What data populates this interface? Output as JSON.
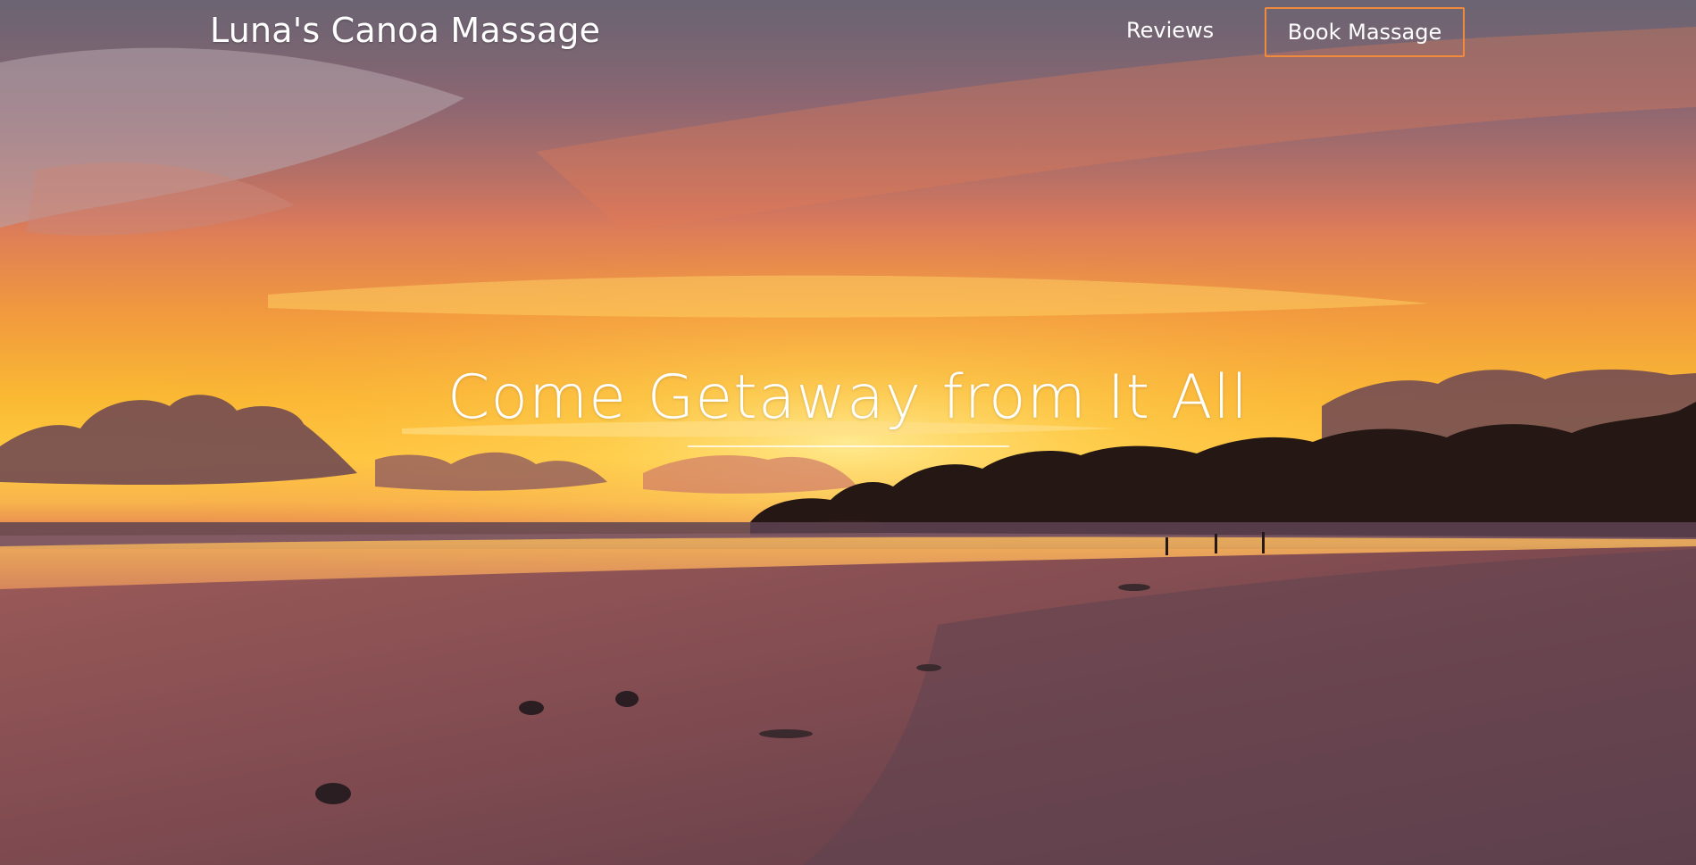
{
  "header": {
    "brand": "Luna's Canoa Massage",
    "nav_reviews": "Reviews",
    "nav_book": "Book Massage"
  },
  "hero": {
    "headline": "Come Getaway from It All",
    "image": "sunset-beach-photo"
  },
  "colors": {
    "accent_border": "#f08a3c",
    "text": "#ffffff"
  }
}
